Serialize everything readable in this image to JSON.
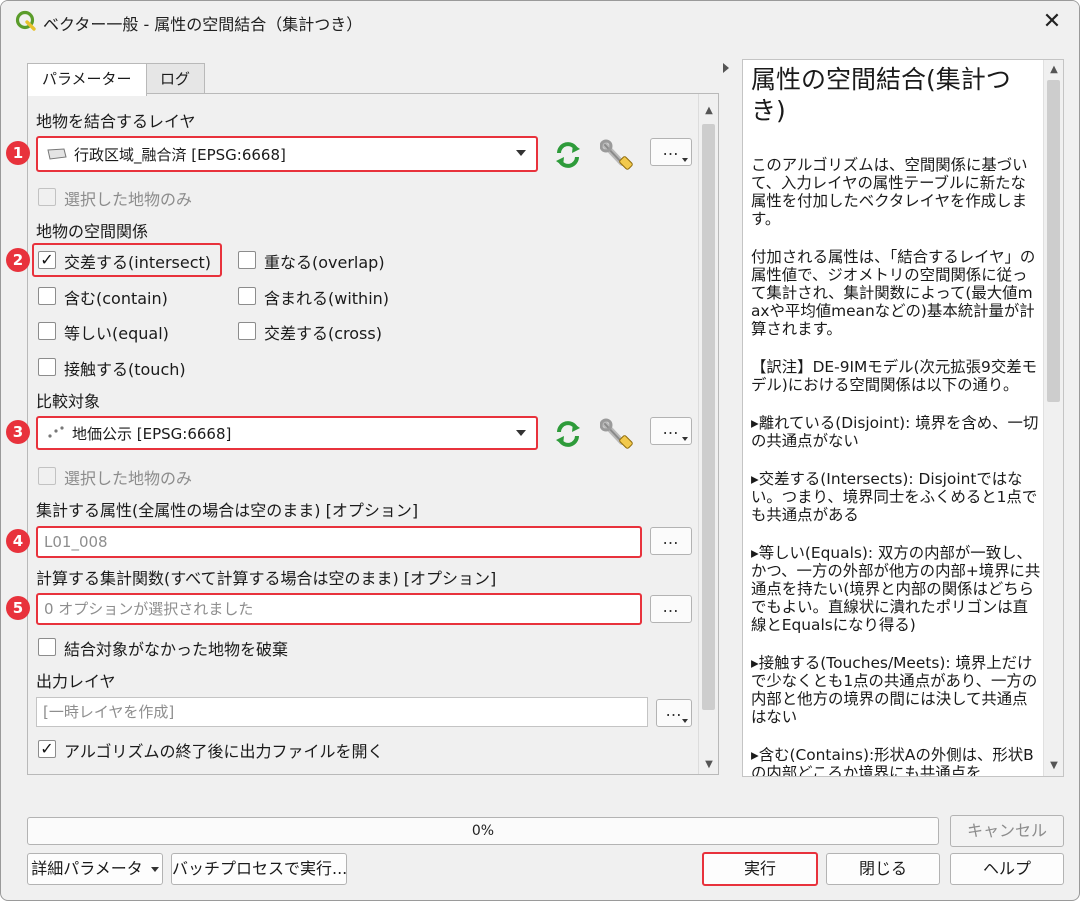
{
  "window": {
    "title": "ベクター一般 - 属性の空間結合（集計つき）",
    "close_glyph": "✕"
  },
  "tabs": [
    {
      "label": "パラメーター",
      "active": true
    },
    {
      "label": "ログ",
      "active": false
    }
  ],
  "params": {
    "join_layer": {
      "label": "地物を結合するレイヤ",
      "value": "行政区域_融合済 [EPSG:6668]",
      "badge": "1",
      "selected_only_label": "選択した地物のみ",
      "dots": "…"
    },
    "predicates": {
      "label": "地物の空間関係",
      "badge": "2",
      "items": [
        {
          "label": "交差する(intersect)",
          "checked": true
        },
        {
          "label": "重なる(overlap)",
          "checked": false
        },
        {
          "label": "含む(contain)",
          "checked": false
        },
        {
          "label": "含まれる(within)",
          "checked": false
        },
        {
          "label": "等しい(equal)",
          "checked": false
        },
        {
          "label": "交差する(cross)",
          "checked": false
        },
        {
          "label": "接触する(touch)",
          "checked": false
        }
      ]
    },
    "compare_layer": {
      "label": "比較対象",
      "value": "地価公示 [EPSG:6668]",
      "badge": "3",
      "selected_only_label": "選択した地物のみ",
      "dots": "…"
    },
    "summary_fields": {
      "label": "集計する属性(全属性の場合は空のまま) [オプション]",
      "value": "L01_008",
      "badge": "4",
      "dots": "…"
    },
    "summaries": {
      "label": "計算する集計関数(すべて計算する場合は空のまま) [オプション]",
      "value": "0 オプションが選択されました",
      "badge": "5",
      "dots": "…"
    },
    "discard_nonmatching": {
      "label": "結合対象がなかった地物を破棄",
      "checked": false
    },
    "output": {
      "label": "出力レイヤ",
      "placeholder": "[一時レイヤを作成]",
      "dots": "…"
    },
    "open_after": {
      "label": "アルゴリズムの終了後に出力ファイルを開く",
      "checked": true
    }
  },
  "help": {
    "title": "属性の空間結合(集計つき)",
    "paragraphs": [
      "このアルゴリズムは、空間関係に基づいて、入力レイヤの属性テーブルに新たな属性を付加したベクタレイヤを作成します。",
      "付加される属性は、「結合するレイヤ」の属性値で、ジオメトリの空間関係に従って集計され、集計関数によって(最大値maxや平均値meanなどの)基本統計量が計算されます。",
      "【訳注】DE-9IMモデル(次元拡張9交差モデル)における空間関係は以下の通り。",
      "▸離れている(Disjoint): 境界を含め、一切の共通点がない",
      "▸交差する(Intersects): Disjointではない。つまり、境界同士をふくめると1点でも共通点がある",
      "▸等しい(Equals): 双方の内部が一致し、かつ、一方の外部が他方の内部+境界に共通点を持たい(境界と内部の関係はどちらでもよい。直線状に潰れたポリゴンは直線とEqualsになり得る)",
      "▸接触する(Touches/Meets): 境界上だけで少なくとも1点の共通点があり、一方の内部と他方の境界の間には決して共通点はない",
      "▸含む(Contains):形状Aの外側は、形状Bの内部どころか境界にも共通点を"
    ]
  },
  "progress": {
    "value": 0,
    "text": "0%"
  },
  "buttons": {
    "cancel": "キャンセル",
    "advanced": "詳細パラメータ",
    "batch": "バッチプロセスで実行...",
    "run": "実行",
    "close": "閉じる",
    "help": "ヘルプ"
  },
  "colors": {
    "highlight": "#e8323c",
    "qgis_green": "#5a9c2b",
    "sync_green": "#2e9b3a"
  },
  "icons": {
    "app": "qgis-logo-icon",
    "polygon_layer": "polygon-layer-icon",
    "point_layer": "point-layer-icon",
    "sync": "iterate-sync-icon",
    "wrench": "wrench-icon"
  }
}
